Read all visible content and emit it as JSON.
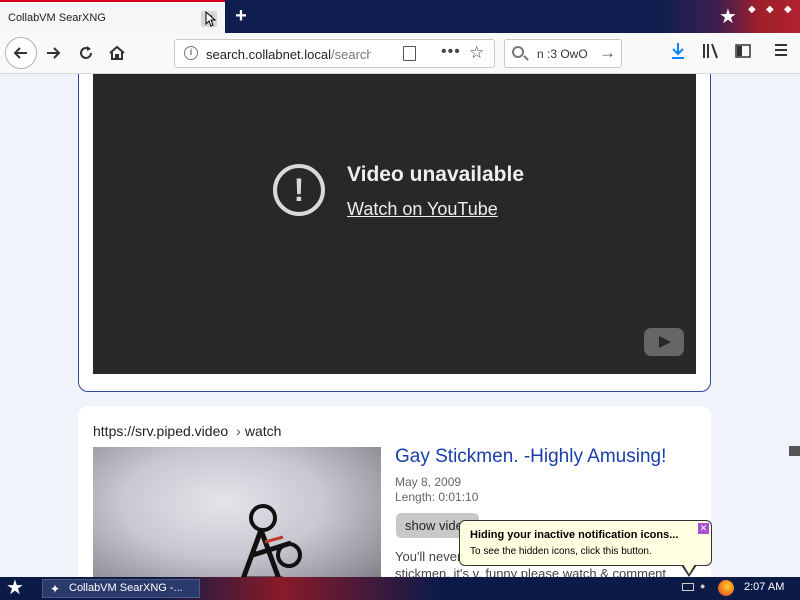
{
  "browser": {
    "tab_title": "CollabVM SearXNG",
    "tab_close": "✕",
    "new_tab": "+",
    "url_host": "search.collabnet.local",
    "url_path": "/search",
    "search_query": "n :3 OwO"
  },
  "video": {
    "title": "Video unavailable",
    "link": "Watch on YouTube"
  },
  "result": {
    "url_host": "https://srv.piped.video",
    "url_path": "watch",
    "title": "Gay Stickmen. -Highly Amusing!",
    "date": "May 8, 2009",
    "length": "Length: 0:01:10",
    "show_video": "show video",
    "snippet_line1": "You'll never",
    "snippet_line2": "stickmen. it's v. funny please watch & comment"
  },
  "notification": {
    "title": "Hiding your inactive notification icons...",
    "text": "To see the hidden icons, click this button."
  },
  "taskbar": {
    "task_label": "CollabVM SearXNG -...",
    "clock": "2:07 AM"
  }
}
